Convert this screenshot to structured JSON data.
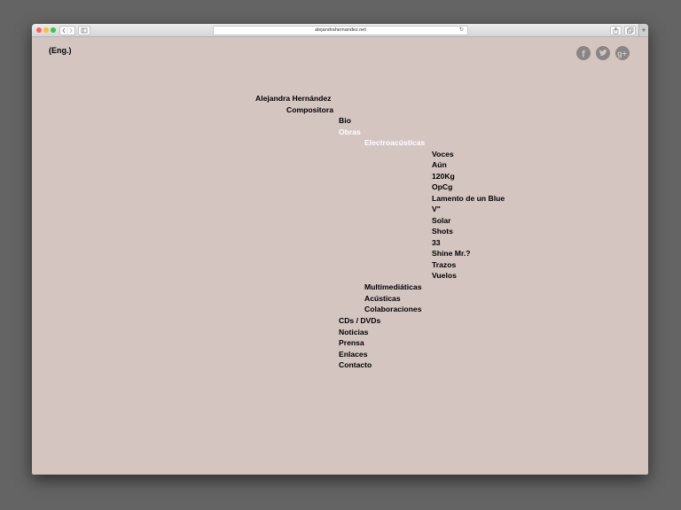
{
  "browser": {
    "url": "alejandrahernandez.net"
  },
  "header": {
    "lang_link": "(Eng.)"
  },
  "social": {
    "items": [
      {
        "name": "facebook-icon",
        "glyph": "f"
      },
      {
        "name": "twitter-icon",
        "glyph": "bird"
      },
      {
        "name": "google-plus-icon",
        "glyph": "g+"
      }
    ],
    "color": "#8a8585"
  },
  "colors": {
    "page_background": "#d4c5c1",
    "active_text": "#ffffff",
    "text": "#000000"
  },
  "menu": {
    "site_name": "Alejandra Hernández",
    "role": "Compositora",
    "bio": "Bio",
    "obras": "Obras",
    "electroacusticas": "Electroacústicas",
    "works": [
      "Voces",
      "Aún",
      "120Kg",
      "OpCg",
      "Lamento de un Blue",
      "V\"",
      "Solar",
      "Shots",
      "33",
      "Shine Mr.?",
      "Trazos",
      "Vuelos"
    ],
    "multimediaticas": "Multimediáticas",
    "acusticas": "Acústicas",
    "colaboraciones": "Colaboraciones",
    "cds": "CDs / DVDs",
    "noticias": "Noticias",
    "prensa": "Prensa",
    "enlaces": "Enlaces",
    "contacto": "Contacto"
  }
}
